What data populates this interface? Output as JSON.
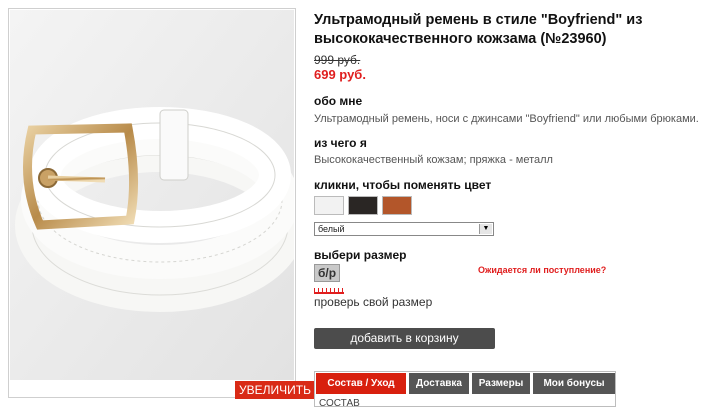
{
  "product": {
    "title": "Ультрамодный ремень в стиле \"Boyfriend\" из высококачественного кожзама (№23960)",
    "old_price": "999 руб.",
    "price": "699 руб."
  },
  "zoom_button": "УВЕЛИЧИТЬ",
  "about": {
    "heading": "обо мне",
    "text": "Ультрамодный ремень, носи с джинсами \"Boyfriend\" или любыми брюками."
  },
  "material": {
    "heading": "из чего я",
    "text": "Высококачественный кожзам; пряжка - металл"
  },
  "color": {
    "heading": "кликни, чтобы поменять цвет",
    "swatches": [
      {
        "name": "белый",
        "color": "#f2f2f2"
      },
      {
        "name": "чёрный",
        "color": "#2a2624"
      },
      {
        "name": "коричневый",
        "color": "#b3562a"
      }
    ],
    "selected": "белый"
  },
  "size": {
    "heading": "выбери размер",
    "value": "б/р",
    "inquiry_link": "Ожидается ли поступление?",
    "check_link": "проверь свой размер"
  },
  "cart_button": "добавить в корзину",
  "tabs": [
    {
      "label": "Состав / Уход",
      "active": true
    },
    {
      "label": "Доставка",
      "active": false
    },
    {
      "label": "Размеры",
      "active": false
    },
    {
      "label": "Мои бонусы",
      "active": false
    }
  ],
  "tab_content_heading": "СОСТАВ"
}
